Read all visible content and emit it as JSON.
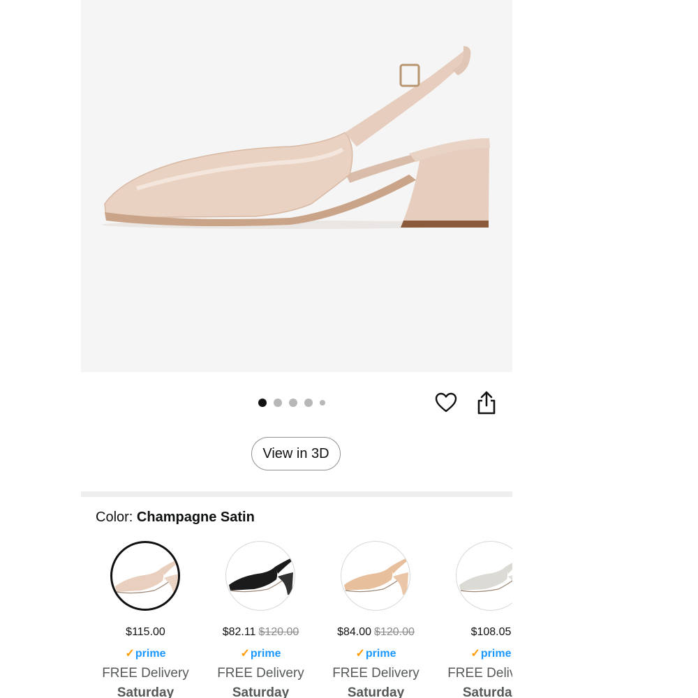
{
  "product": {
    "image_alt": "Champagne satin slingback block-heel pump",
    "carousel": {
      "total_images": 5,
      "active_index": 0
    }
  },
  "actions": {
    "favorite_icon": "heart-icon",
    "share_icon": "share-icon",
    "view_3d_label": "View in 3D"
  },
  "color": {
    "label": "Color: ",
    "selected_name": "Champagne Satin",
    "options": [
      {
        "price": "$115.00",
        "list_price": "",
        "prime_check": "✓",
        "prime_word": "prime",
        "delivery": "FREE Delivery",
        "day": "Saturday",
        "shoe_color": "#e9cfbd",
        "selected": true
      },
      {
        "price": "$82.11",
        "list_price": "$120.00",
        "prime_check": "✓",
        "prime_word": "prime",
        "delivery": "FREE Delivery",
        "day": "Saturday",
        "shoe_color": "#1b1b1b",
        "selected": false
      },
      {
        "price": "$84.00",
        "list_price": "$120.00",
        "prime_check": "✓",
        "prime_word": "prime",
        "delivery": "FREE Delivery",
        "day": "Saturday",
        "shoe_color": "#e8bf9c",
        "selected": false
      },
      {
        "price": "$108.05",
        "list_price": "",
        "prime_check": "✓",
        "prime_word": "prime",
        "delivery": "FREE Delivery",
        "day": "Saturday",
        "shoe_color": "#dcdad5",
        "selected": false
      }
    ]
  },
  "colors": {
    "accent_prime": "#1a98ff",
    "prime_check": "#ff9900",
    "hero_bg": "#f5f5f5"
  }
}
